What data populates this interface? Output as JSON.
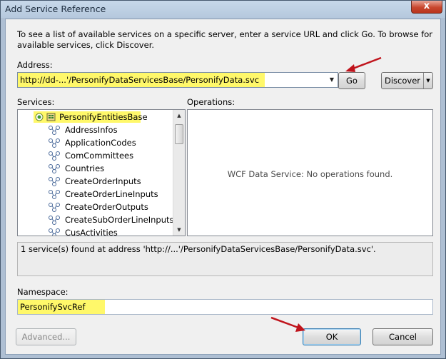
{
  "window": {
    "title": "Add Service Reference",
    "close_label": "x"
  },
  "intro": "To see a list of available services on a specific server, enter a service URL and click Go. To browse for available services, click Discover.",
  "address": {
    "label": "Address:",
    "value": "http://dd-...'/PersonifyDataServicesBase/PersonifyData.svc"
  },
  "buttons": {
    "go": "Go",
    "discover": "Discover",
    "advanced": "Advanced...",
    "ok": "OK",
    "cancel": "Cancel"
  },
  "services": {
    "label": "Services:",
    "root": "PersonifyEntitiesBase",
    "items": [
      "AddressInfos",
      "ApplicationCodes",
      "ComCommittees",
      "Countries",
      "CreateOrderInputs",
      "CreateOrderLineInputs",
      "CreateOrderOutputs",
      "CreateSubOrderLineInputs",
      "CusActivities"
    ]
  },
  "operations": {
    "label": "Operations:",
    "message": "WCF Data Service: No operations found."
  },
  "status": "1 service(s) found at address 'http://...'/PersonifyDataServicesBase/PersonifyData.svc'.",
  "namespace": {
    "label": "Namespace:",
    "value": "PersonifySvcRef"
  },
  "colors": {
    "highlight": "#fff86a",
    "annotation_arrow": "#c0141c",
    "window_frame": "#aebfd3"
  }
}
